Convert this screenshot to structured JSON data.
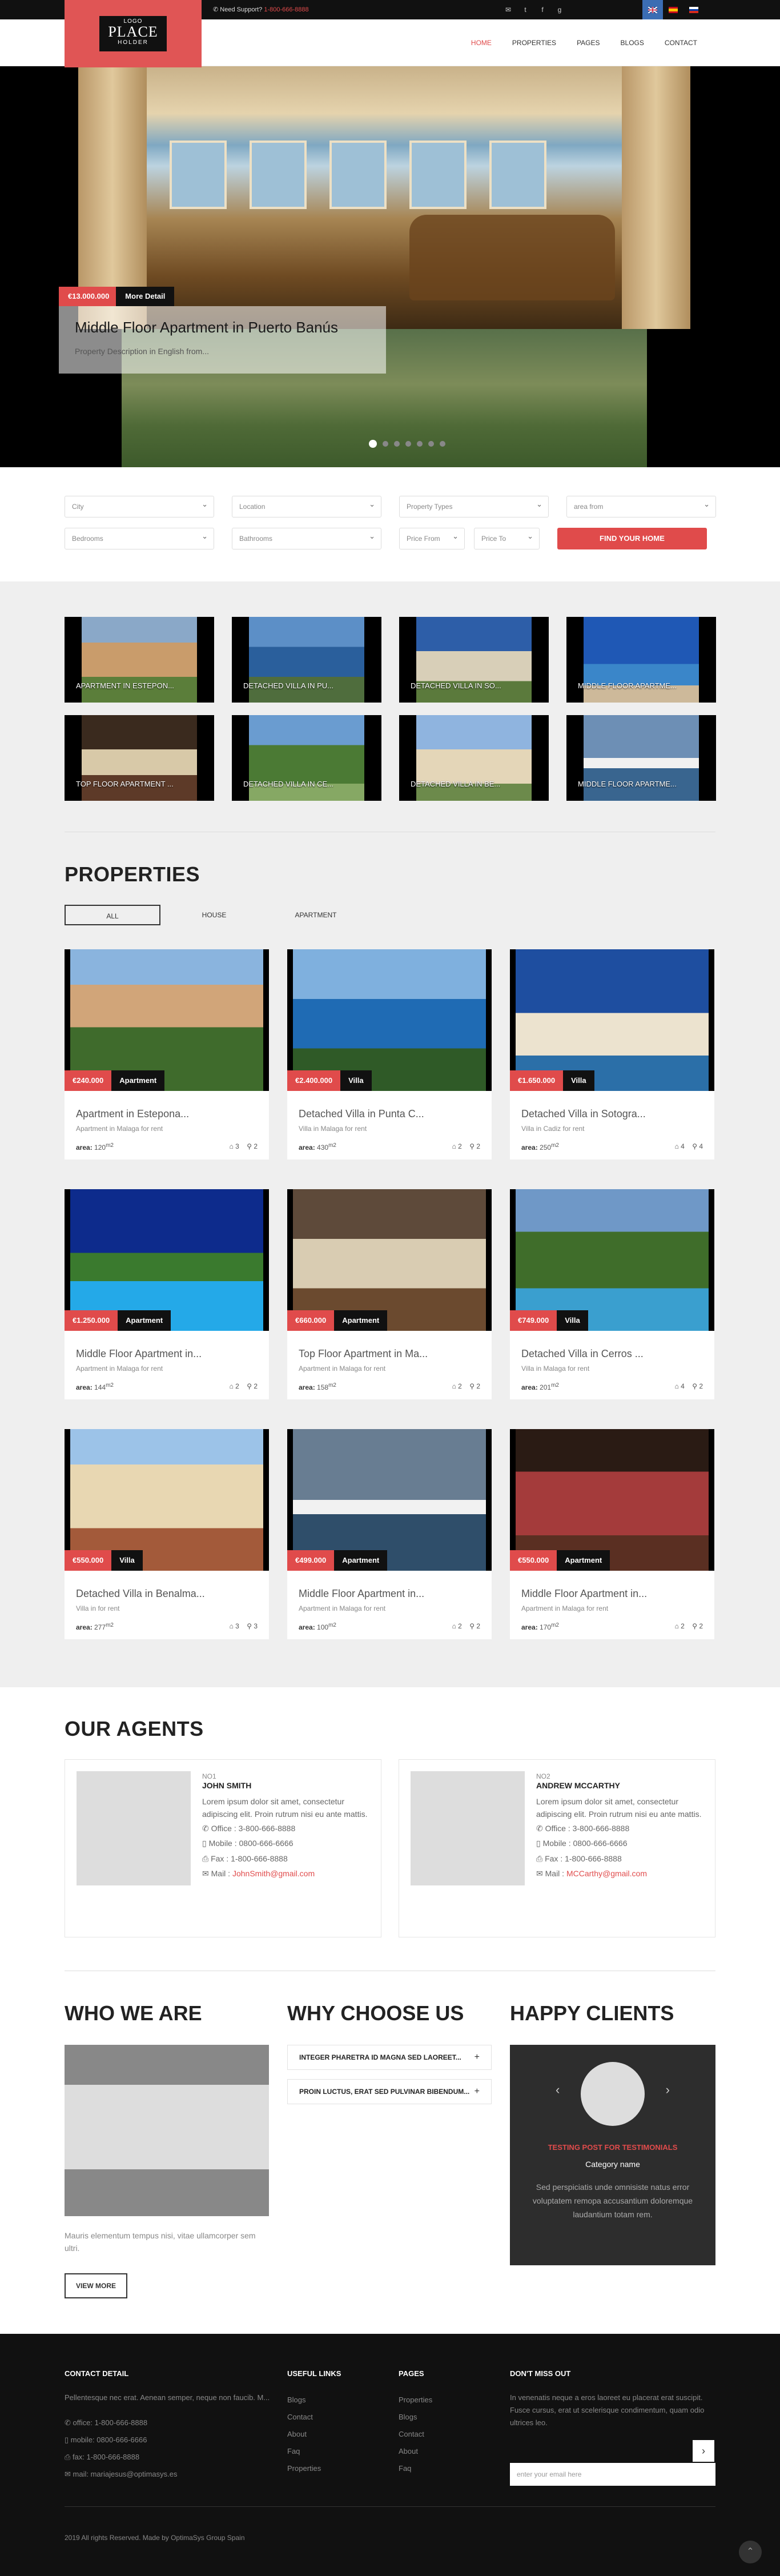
{
  "topbar": {
    "support_label": "Need Support?",
    "support_phone": "1-800-666-8888",
    "social": [
      "mail-icon",
      "twitter-icon",
      "facebook-icon",
      "googleplus-icon"
    ]
  },
  "header": {
    "logo_small": "LOGO",
    "logo_big": "PLACE",
    "logo_holder": "HOLDER",
    "nav": [
      "HOME",
      "PROPERTIES",
      "PAGES",
      "BLOGS",
      "CONTACT"
    ],
    "active_nav": "HOME"
  },
  "hero": {
    "price": "€13.000.000",
    "more": "More Detail",
    "title": "Middle Floor Apartment in Puerto Banús",
    "description": "Property Description in English from..."
  },
  "search": {
    "city": "City",
    "location": "Location",
    "property_types": "Property Types",
    "area_from": "area from",
    "bedrooms": "Bedrooms",
    "bathrooms": "Bathrooms",
    "price_from": "Price From",
    "price_to": "Price To",
    "button": "FIND YOUR HOME"
  },
  "tiles": [
    "APARTMENT IN ESTEPON...",
    "DETACHED VILLA IN PU...",
    "DETACHED VILLA IN SO...",
    "MIDDLE FLOOR APARTME...",
    "TOP FLOOR APARTMENT ...",
    "DETACHED VILLA IN CE...",
    "DETACHED VILLA IN BE...",
    "MIDDLE FLOOR APARTME..."
  ],
  "properties": {
    "title": "PROPERTIES",
    "filters": [
      "ALL",
      "HOUSE",
      "APARTMENT"
    ],
    "area_label": "area:",
    "items": [
      {
        "price": "€240.000",
        "type": "Apartment",
        "title": "Apartment in Estepona...",
        "sub": "Apartment in Malaga for rent",
        "area": "120",
        "beds": "3",
        "baths": "2"
      },
      {
        "price": "€2.400.000",
        "type": "Villa",
        "title": "Detached Villa in Punta C...",
        "sub": "Villa in Malaga for rent",
        "area": "430",
        "beds": "2",
        "baths": "2"
      },
      {
        "price": "€1.650.000",
        "type": "Villa",
        "title": "Detached Villa in Sotogra...",
        "sub": "Villa in Cadiz for rent",
        "area": "250",
        "beds": "4",
        "baths": "4"
      },
      {
        "price": "€1.250.000",
        "type": "Apartment",
        "title": "Middle Floor Apartment in...",
        "sub": "Apartment in Malaga for rent",
        "area": "144",
        "beds": "2",
        "baths": "2"
      },
      {
        "price": "€660.000",
        "type": "Apartment",
        "title": "Top Floor Apartment in Ma...",
        "sub": "Apartment in Malaga for rent",
        "area": "158",
        "beds": "2",
        "baths": "2"
      },
      {
        "price": "€749.000",
        "type": "Villa",
        "title": "Detached Villa in Cerros ...",
        "sub": "Villa in Malaga for rent",
        "area": "201",
        "beds": "4",
        "baths": "2"
      },
      {
        "price": "€550.000",
        "type": "Villa",
        "title": "Detached Villa in Benalma...",
        "sub": "Villa in for rent",
        "area": "277",
        "beds": "3",
        "baths": "3"
      },
      {
        "price": "€499.000",
        "type": "Apartment",
        "title": "Middle Floor Apartment in...",
        "sub": "Apartment in Malaga for rent",
        "area": "100",
        "beds": "2",
        "baths": "2"
      },
      {
        "price": "€550.000",
        "type": "Apartment",
        "title": "Middle Floor Apartment in...",
        "sub": "Apartment in Malaga for rent",
        "area": "170",
        "beds": "2",
        "baths": "2"
      }
    ]
  },
  "agents": {
    "title": "OUR AGENTS",
    "items": [
      {
        "no": "NO1",
        "name": "JOHN SMITH",
        "bio": "Lorem ipsum dolor sit amet, consectetur adipiscing elit. Proin rutrum nisi eu ante mattis.",
        "office": "Office : 3-800-666-8888",
        "mobile": "Mobile : 0800-666-6666",
        "fax": "Fax : 1-800-666-8888",
        "mail_label": "Mail :",
        "mail": "JohnSmith@gmail.com"
      },
      {
        "no": "NO2",
        "name": "ANDREW MCCARTHY",
        "bio": "Lorem ipsum dolor sit amet, consectetur adipiscing elit. Proin rutrum nisi eu ante mattis.",
        "office": "Office : 3-800-666-8888",
        "mobile": "Mobile : 0800-666-6666",
        "fax": "Fax : 1-800-666-8888",
        "mail_label": "Mail :",
        "mail": "MCCarthy@gmail.com"
      }
    ]
  },
  "who": {
    "title": "WHO WE ARE",
    "text": "Mauris elementum tempus nisi, vitae ullamcorper sem ultri.",
    "button": "VIEW MORE"
  },
  "why": {
    "title": "WHY CHOOSE US",
    "items": [
      "INTEGER PHARETRA ID MAGNA SED LAOREET...",
      "PROIN LUCTUS, ERAT SED PULVINAR BIBENDUM..."
    ]
  },
  "happy": {
    "title": "HAPPY CLIENTS",
    "post": "TESTING POST FOR TESTIMONIALS",
    "category": "Category name",
    "text": "Sed perspiciatis unde omnisiste natus error voluptatem remopa accusantium doloremque laudantium totam rem."
  },
  "footer": {
    "contact_title": "CONTACT DETAIL",
    "contact_desc": "Pellentesque nec erat. Aenean semper, neque non faucib. M...",
    "office": "office: 1-800-666-8888",
    "mobile": "mobile: 0800-666-6666",
    "fax": "fax: 1-800-666-8888",
    "mail": "mail: mariajesus@optimasys.es",
    "links_title": "USEFUL LINKS",
    "links": [
      "Blogs",
      "Contact",
      "About",
      "Faq",
      "Properties"
    ],
    "pages_title": "PAGES",
    "pages": [
      "Properties",
      "Blogs",
      "Contact",
      "About",
      "Faq"
    ],
    "miss_title": "DON'T MISS OUT",
    "miss_text": "In venenatis neque a eros laoreet eu placerat erat suscipit. Fusce cursus, erat ut scelerisque condimentum, quam odio ultrices leo.",
    "email_placeholder": "enter your email here",
    "copyright": "2019 All rights Reserved. Made by OptimaSys Group Spain"
  }
}
